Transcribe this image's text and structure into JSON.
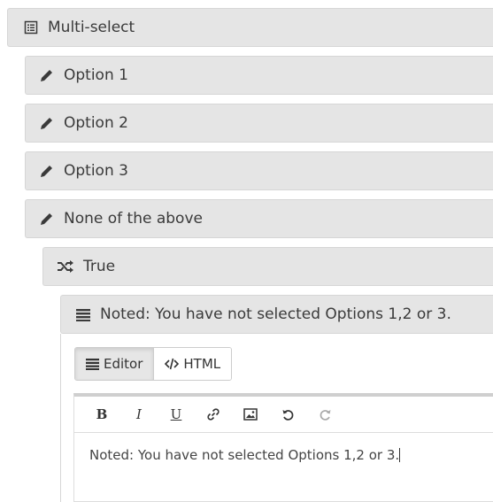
{
  "tree": {
    "root": {
      "label": "Multi-select",
      "icon": "list-icon"
    },
    "options": [
      {
        "label": "Option 1",
        "icon": "pencil-icon"
      },
      {
        "label": "Option 2",
        "icon": "pencil-icon"
      },
      {
        "label": "Option 3",
        "icon": "pencil-icon"
      },
      {
        "label": "None of the above",
        "icon": "pencil-icon"
      }
    ],
    "branch": {
      "label": "True",
      "icon": "shuffle-icon"
    },
    "message": {
      "label": "Noted: You have not selected Options 1,2 or 3.",
      "icon": "align-justify-icon"
    }
  },
  "editor": {
    "tabs": [
      {
        "label": "Editor",
        "icon": "align-justify-icon",
        "active": true
      },
      {
        "label": "HTML",
        "icon": "code-icon",
        "active": false
      }
    ],
    "toolbar": {
      "bold": "B",
      "italic": "I",
      "underline": "U",
      "link_icon": "link-icon",
      "image_icon": "image-icon",
      "undo_icon": "undo-icon",
      "redo_icon": "redo-icon"
    },
    "content": "Noted: You have not selected Options 1,2 or 3."
  },
  "colors": {
    "node_bg": "#e5e5e5",
    "node_border": "#d6d6d6",
    "text": "#333333",
    "disabled": "#aaaaaa"
  }
}
